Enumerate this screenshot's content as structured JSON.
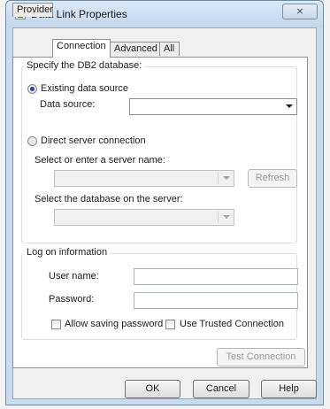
{
  "window": {
    "title": "Data Link Properties",
    "close_glyph": "⨯"
  },
  "tabs": [
    {
      "label": "Provider",
      "active": false
    },
    {
      "label": "Connection",
      "active": true
    },
    {
      "label": "Advanced",
      "active": false
    },
    {
      "label": "All",
      "active": false
    }
  ],
  "db_group": {
    "label": "Specify the DB2 database:",
    "existing_label": "Existing data source",
    "existing_checked": true,
    "data_source_label": "Data source:",
    "data_source_value": "",
    "direct_label": "Direct server connection",
    "direct_checked": false,
    "server_label": "Select or enter a server name:",
    "server_value": "",
    "refresh_label": "Refresh",
    "database_label": "Select the database on the server:",
    "database_value": ""
  },
  "logon_group": {
    "label": "Log on information",
    "user_label": "User name:",
    "user_value": "",
    "password_label": "Password:",
    "password_value": "",
    "allow_saving_label": "Allow saving password",
    "allow_saving_checked": false,
    "trusted_label": "Use Trusted Connection",
    "trusted_checked": false
  },
  "test_connection_label": "Test Connection",
  "footer": {
    "ok_label": "OK",
    "cancel_label": "Cancel",
    "help_label": "Help"
  }
}
